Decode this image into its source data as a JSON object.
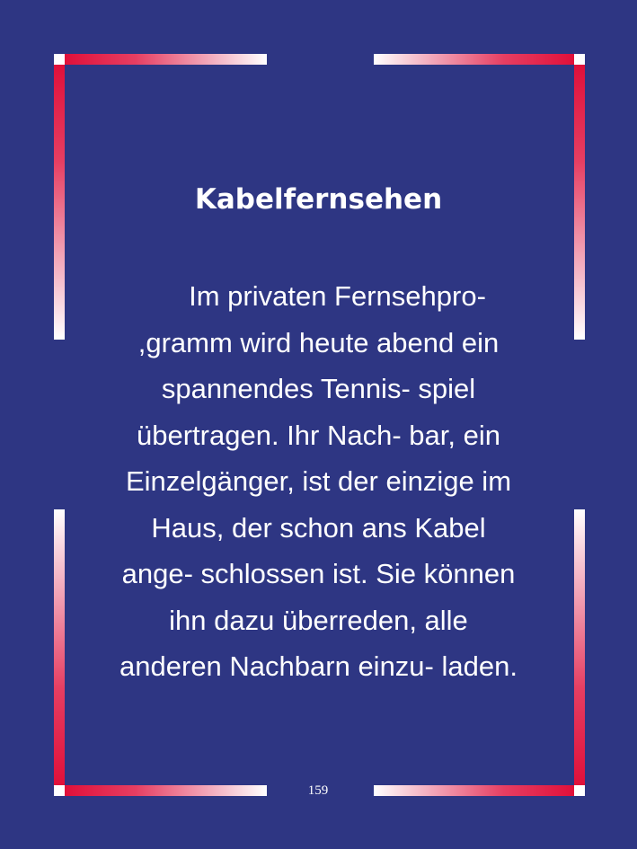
{
  "card": {
    "title": "Kabelfernsehen",
    "body_lines": [
      "Im privaten Fernsehpro-",
      ",gramm wird heute abend ein",
      "spannendes Tennis- spiel",
      "übertragen. Ihr Nach- bar, ein",
      "Einzelgänger, ist der einzige im",
      "Haus, der schon ans Kabel",
      "ange- schlossen ist. Sie können",
      "ihn dazu überreden, alle",
      "anderen Nachbarn einzu- laden."
    ],
    "page_number": "159"
  },
  "colors": {
    "background": "#2e3683",
    "frame_red": "#e0103a",
    "frame_white": "#ffffff",
    "text": "#ffffff"
  }
}
